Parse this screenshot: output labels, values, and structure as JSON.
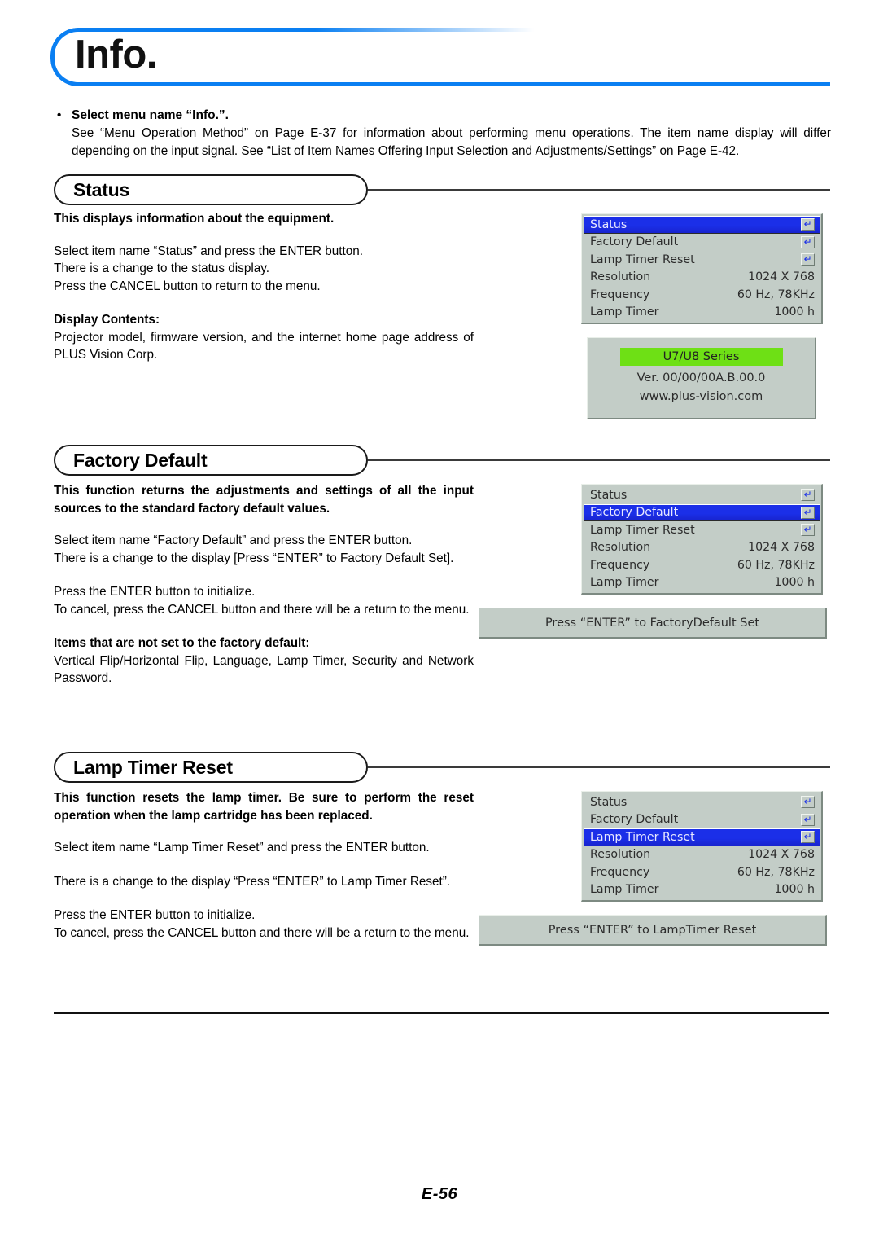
{
  "page": {
    "title": "Info.",
    "page_number": "E-56"
  },
  "intro": {
    "bullet": "Select menu name “Info.”.",
    "body": "See “Menu Operation Method” on Page E-37 for information about performing menu operations. The item name display will differ depending on the input signal. See “List of Item Names Offering Input Selection and Adjustments/Settings” on Page E-42."
  },
  "colors": {
    "title_accent": "#0a7ff2",
    "osd_background": "#c3cdc7",
    "osd_highlight": "#1b2fe8",
    "model_bar": "#6ee015"
  },
  "sections": [
    {
      "heading": "Status",
      "paragraphs": [
        "This displays information about the equipment.",
        "Select item name “Status” and press the ENTER button.",
        "There is a change to the status display.",
        "Press the CANCEL button to return to the menu.",
        "Display Contents:",
        "Projector model, firmware version, and the internet home page address of PLUS Vision Corp."
      ]
    },
    {
      "heading": "Factory Default",
      "paragraphs": [
        "This function returns the adjustments and settings of all the input sources to the standard factory default values.",
        "Select item name “Factory Default” and press the ENTER button.",
        "There is a change to the display [Press “ENTER” to Factory Default Set].",
        "Press the ENTER button to initialize.",
        "To cancel, press the CANCEL button and there will be a return to the menu.",
        "Items that are not set to the factory default:",
        "Vertical Flip/Horizontal Flip, Language, Lamp Timer, Security and Network Password."
      ]
    },
    {
      "heading": "Lamp Timer Reset",
      "paragraphs": [
        "This function resets the lamp timer. Be sure to perform the reset operation when the lamp cartridge has been replaced.",
        "Select item name “Lamp Timer Reset” and press the ENTER button.",
        "There is a change to the display “Press “ENTER” to Lamp Timer Reset”.",
        "Press the ENTER button to initialize.",
        "To cancel, press the CANCEL button and there will be a return to the menu."
      ]
    }
  ],
  "osd_menus": [
    {
      "selected_index": 0,
      "rows": [
        {
          "label": "Status",
          "value": "",
          "icon": "enter-key-icon"
        },
        {
          "label": "Factory Default",
          "value": "",
          "icon": "enter-key-icon"
        },
        {
          "label": "Lamp Timer Reset",
          "value": "",
          "icon": "enter-key-icon"
        },
        {
          "label": "Resolution",
          "value": "1024 X 768",
          "icon": ""
        },
        {
          "label": "Frequency",
          "value": "60 Hz, 78KHz",
          "icon": ""
        },
        {
          "label": "Lamp Timer",
          "value": "1000 h",
          "icon": ""
        }
      ]
    },
    {
      "selected_index": 1,
      "rows": [
        {
          "label": "Status",
          "value": "",
          "icon": "enter-key-icon"
        },
        {
          "label": "Factory Default",
          "value": "",
          "icon": "enter-key-icon"
        },
        {
          "label": "Lamp Timer Reset",
          "value": "",
          "icon": "enter-key-icon"
        },
        {
          "label": "Resolution",
          "value": "1024 X 768",
          "icon": ""
        },
        {
          "label": "Frequency",
          "value": "60 Hz, 78KHz",
          "icon": ""
        },
        {
          "label": "Lamp Timer",
          "value": "1000 h",
          "icon": ""
        }
      ]
    },
    {
      "selected_index": 2,
      "rows": [
        {
          "label": "Status",
          "value": "",
          "icon": "enter-key-icon"
        },
        {
          "label": "Factory Default",
          "value": "",
          "icon": "enter-key-icon"
        },
        {
          "label": "Lamp Timer Reset",
          "value": "",
          "icon": "enter-key-icon"
        },
        {
          "label": "Resolution",
          "value": "1024 X 768",
          "icon": ""
        },
        {
          "label": "Frequency",
          "value": "60 Hz, 78KHz",
          "icon": ""
        },
        {
          "label": "Lamp Timer",
          "value": "1000 h",
          "icon": ""
        }
      ]
    }
  ],
  "status_info_panel": {
    "model": "U7/U8 Series",
    "version": "Ver. 00/00/00A.B.00.0",
    "url": "www.plus-vision.com"
  },
  "message_bars": {
    "factory_default": "Press “ENTER” to FactoryDefault Set",
    "lamp_timer_reset": "Press “ENTER” to LampTimer Reset"
  },
  "icons": {
    "enter_key": "↵",
    "bullet": "•"
  }
}
